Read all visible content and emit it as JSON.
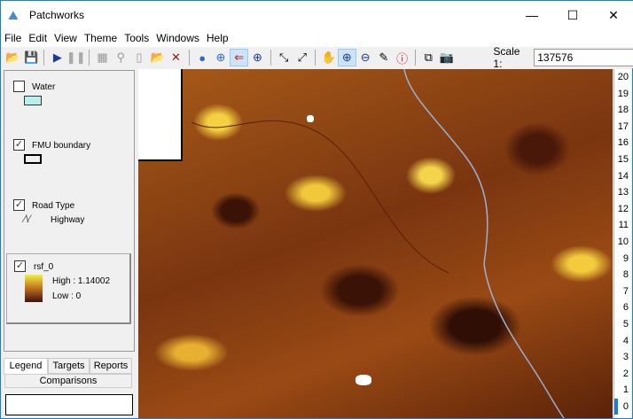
{
  "window": {
    "title": "Patchworks",
    "minimize": "—",
    "maximize": "☐",
    "close": "✕"
  },
  "menu": [
    "File",
    "Edit",
    "View",
    "Theme",
    "Tools",
    "Windows",
    "Help"
  ],
  "toolbar": {
    "scale_label": "Scale 1:",
    "scale_value": "137576"
  },
  "legend": {
    "layers": [
      {
        "name": "Water",
        "checked": false
      },
      {
        "name": "FMU boundary",
        "checked": true
      },
      {
        "name": "Road Type",
        "checked": true,
        "sub": "Highway"
      },
      {
        "name": "rsf_0",
        "checked": true,
        "high": "High : 1.14002",
        "low": "Low : 0"
      }
    ]
  },
  "tabs": {
    "legend": "Legend",
    "targets": "Targets",
    "reports": "Reports",
    "comparisons": "Comparisons"
  },
  "scale_levels": [
    "20",
    "19",
    "18",
    "17",
    "16",
    "15",
    "14",
    "13",
    "12",
    "11",
    "10",
    "9",
    "8",
    "7",
    "6",
    "5",
    "4",
    "3",
    "2",
    "1",
    "0"
  ],
  "colors": {
    "accent": "#1a7fd4"
  }
}
